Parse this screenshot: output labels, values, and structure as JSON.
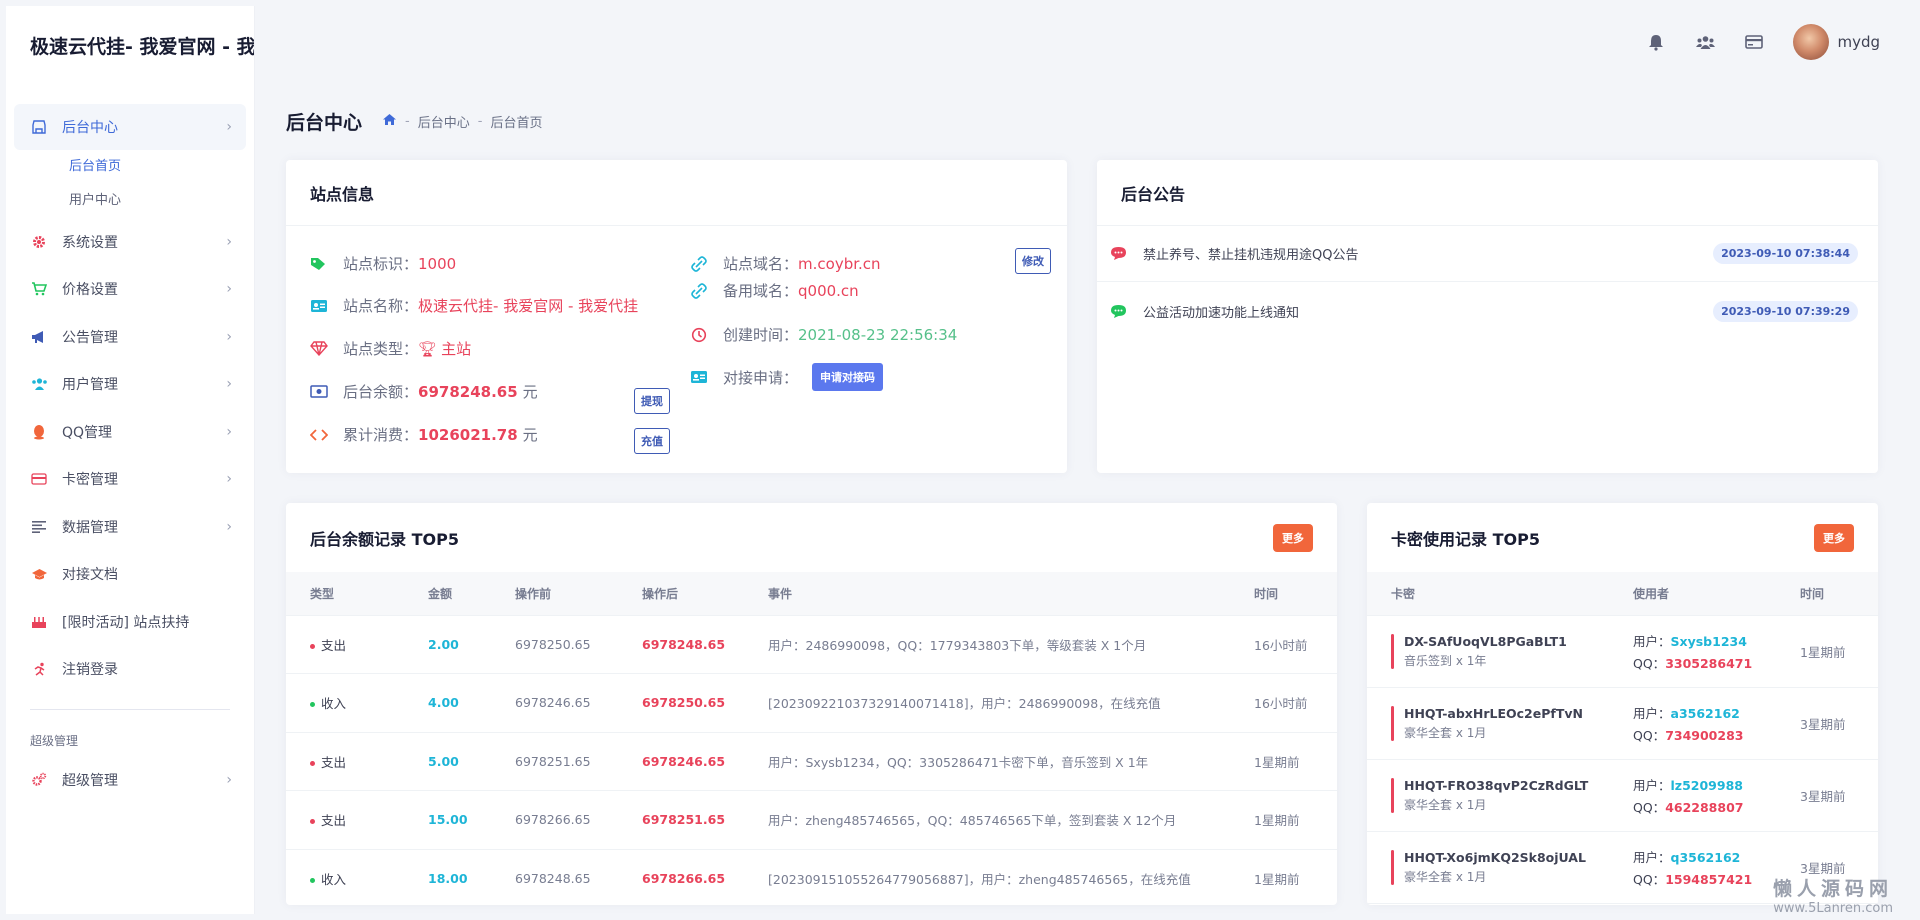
{
  "app": {
    "brand": "极速云代挂- 我爱官网 - 我"
  },
  "sidebar": {
    "items": [
      {
        "label": "后台中心",
        "icon": "store-icon",
        "color": "#3f6ad8",
        "active": true
      },
      {
        "label": "系统设置",
        "icon": "gear-icon",
        "color": "#e8435b"
      },
      {
        "label": "价格设置",
        "icon": "cart-icon",
        "color": "#22c55e"
      },
      {
        "label": "公告管理",
        "icon": "megaphone-icon",
        "color": "#3f5bb5"
      },
      {
        "label": "用户管理",
        "icon": "users-icon",
        "color": "#1eb5d7"
      },
      {
        "label": "QQ管理",
        "icon": "qq-icon",
        "color": "#f1663b"
      },
      {
        "label": "卡密管理",
        "icon": "card-icon",
        "color": "#e8435b"
      },
      {
        "label": "数据管理",
        "icon": "list-icon",
        "color": "#5e6278"
      },
      {
        "label": "对接文档",
        "icon": "graduation-cap-icon",
        "color": "#f1663b"
      },
      {
        "label": "[限时活动] 站点扶持",
        "icon": "cake-icon",
        "color": "#e8435b"
      },
      {
        "label": "注销登录",
        "icon": "running-icon",
        "color": "#e8435b"
      }
    ],
    "subitems": [
      "后台首页",
      "用户中心"
    ],
    "section_label": "超级管理",
    "super_item": {
      "label": "超级管理",
      "icon": "cogs-icon",
      "color": "#e8435b"
    }
  },
  "topbar": {
    "username": "mydg",
    "icons": [
      "bell-icon",
      "users-icon",
      "credit-card-icon"
    ]
  },
  "page": {
    "title": "后台中心",
    "breadcrumb": [
      "后台中心",
      "后台首页"
    ]
  },
  "site_info": {
    "title": "站点信息",
    "id_label": "站点标识：",
    "id_value": "1000",
    "name_label": "站点名称：",
    "name_value": "极速云代挂- 我爱官网 - 我爱代挂",
    "type_label": "站点类型：",
    "type_value": "主站",
    "balance_label": "后台余额：",
    "balance_value": "6978248.65",
    "balance_unit": "元",
    "spent_label": "累计消费：",
    "spent_value": "1026021.78",
    "spent_unit": "元",
    "domain_label": "站点域名：",
    "domain_value": "m.coybr.cn",
    "backup_label": "备用域名：",
    "backup_value": "q000.cn",
    "created_label": "创建时间：",
    "created_value": "2021-08-23 22:56:34",
    "api_label": "对接申请：",
    "btn_edit": "修改",
    "btn_withdraw": "提现",
    "btn_recharge": "充值",
    "btn_apply": "申请对接码"
  },
  "notices": {
    "title": "后台公告",
    "items": [
      {
        "text": "禁止养号、禁止挂机违规用途QQ公告",
        "time": "2023-09-10 07:38:44",
        "icon_color": "#e8435b"
      },
      {
        "text": "公益活动加速功能上线通知",
        "time": "2023-09-10 07:39:29",
        "icon_color": "#22c55e"
      }
    ]
  },
  "balance_log": {
    "title": "后台余额记录 TOP5",
    "more": "更多",
    "headers": [
      "类型",
      "金额",
      "操作前",
      "操作后",
      "事件",
      "时间"
    ],
    "rows": [
      {
        "type": "支出",
        "dot": "#e8435b",
        "amount": "2.00",
        "before": "6978250.65",
        "after": "6978248.65",
        "event": "用户：2486990098，QQ：1779343803下单，等级套装 X 1个月",
        "time": "16小时前"
      },
      {
        "type": "收入",
        "dot": "#22c55e",
        "amount": "4.00",
        "before": "6978246.65",
        "after": "6978250.65",
        "event": "[20230922103732914007141​8]，用户：2486990098，在线充值",
        "time": "16小时前"
      },
      {
        "type": "支出",
        "dot": "#e8435b",
        "amount": "5.00",
        "before": "6978251.65",
        "after": "6978246.65",
        "event": "用户：Sxysb1234，QQ：3305286471卡密下单，音乐签到 X 1年",
        "time": "1星期前"
      },
      {
        "type": "支出",
        "dot": "#e8435b",
        "amount": "15.00",
        "before": "6978266.65",
        "after": "6978251.65",
        "event": "用户：zheng485746565，QQ：485746565下单，签到套装 X 12个月",
        "time": "1星期前"
      },
      {
        "type": "收入",
        "dot": "#22c55e",
        "amount": "18.00",
        "before": "6978248.65",
        "after": "6978266.65",
        "event": "[20230915105526477905688​7]，用户：zheng485746565，在线充值",
        "time": "1星期前"
      }
    ]
  },
  "card_log": {
    "title": "卡密使用记录 TOP5",
    "more": "更多",
    "headers": [
      "卡密",
      "使用者",
      "时间"
    ],
    "user_label": "用户：",
    "qq_label": "QQ：",
    "rows": [
      {
        "code": "DX-SAfUoqVL8PGaBLT1",
        "desc": "音乐签到 x 1年",
        "user": "Sxysb1234",
        "qq": "3305286471",
        "time": "1星期前"
      },
      {
        "code": "HHQT-abxHrLEOc2ePfTvN",
        "desc": "豪华全套 x 1月",
        "user": "a3562162",
        "qq": "734900283",
        "time": "3星期前"
      },
      {
        "code": "HHQT-FRO38qvP2CzRdGLT",
        "desc": "豪华全套 x 1月",
        "user": "lz5209988",
        "qq": "462288807",
        "time": "3星期前"
      },
      {
        "code": "HHQT-Xo6jmKQ2Sk8ojUAL",
        "desc": "豪华全套 x 1月",
        "user": "q3562162",
        "qq": "1594857421",
        "time": "3星期前"
      }
    ]
  },
  "watermark": {
    "line1": "懒人源码网",
    "line2": "www.5Lanren.com"
  }
}
